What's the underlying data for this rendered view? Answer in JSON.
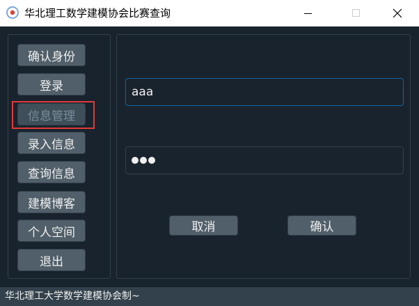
{
  "window": {
    "title": "华北理工数学建模协会比赛查询",
    "app_icon": "app-logo-icon"
  },
  "sidebar": {
    "items": [
      {
        "label": "确认身份"
      },
      {
        "label": "登录"
      },
      {
        "label": "信息管理",
        "state": "disabled",
        "highlighted": true
      },
      {
        "label": "录入信息"
      },
      {
        "label": "查询信息"
      },
      {
        "label": "建模博客"
      },
      {
        "label": "个人空间"
      },
      {
        "label": "退出"
      }
    ]
  },
  "form": {
    "username_value": "aaa",
    "password_length": 3,
    "cancel_label": "取消",
    "confirm_label": "确认"
  },
  "statusbar": {
    "text": "华北理工大学数学建模协会制~"
  },
  "colors": {
    "background": "#19232d",
    "button": "#505f69",
    "border": "#32414b",
    "focus_border": "#1464a0",
    "highlight": "#e03a3a",
    "text": "#f0f0f0"
  }
}
